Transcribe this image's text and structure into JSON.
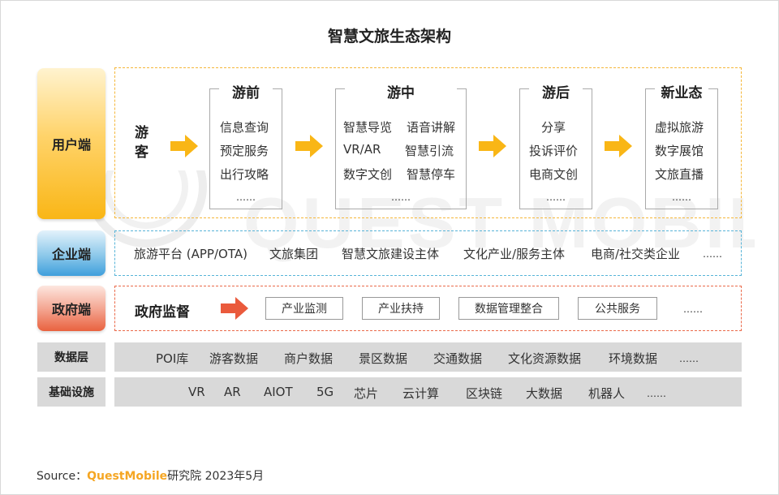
{
  "title": "智慧文旅生态架构",
  "watermark": "QUEST MOBILE",
  "layers": {
    "user": "用户端",
    "enterprise": "企业端",
    "government": "政府端",
    "data": "数据层",
    "infrastructure": "基础设施"
  },
  "user_layer": {
    "traveler": "游客",
    "stages": [
      {
        "title": "游前",
        "items": [
          "信息查询",
          "预定服务",
          "出行攻略"
        ],
        "more": "……"
      },
      {
        "title": "游中",
        "items": [
          "智慧导览",
          "语音讲解",
          "VR/AR",
          "智慧引流",
          "数字文创",
          "智慧停车"
        ],
        "more": "……"
      },
      {
        "title": "游后",
        "items": [
          "分享",
          "投诉评价",
          "电商文创"
        ],
        "more": "……"
      },
      {
        "title": "新业态",
        "items": [
          "虚拟旅游",
          "数字展馆",
          "文旅直播"
        ],
        "more": "……"
      }
    ]
  },
  "enterprise_layer": {
    "items": [
      "旅游平台 (APP/OTA)",
      "文旅集团",
      "智慧文旅建设主体",
      "文化产业/服务主体",
      "电商/社交类企业",
      "……"
    ]
  },
  "government_layer": {
    "label": "政府监督",
    "items": [
      "产业监测",
      "产业扶持",
      "数据管理整合",
      "公共服务"
    ],
    "more": "……"
  },
  "data_layer": {
    "items": [
      "POI库",
      "游客数据",
      "商户数据",
      "景区数据",
      "交通数据",
      "文化资源数据",
      "环境数据",
      "……"
    ]
  },
  "infra_layer": {
    "items": [
      "VR",
      "AR",
      "AIOT",
      "5G",
      "芯片",
      "云计算",
      "区块链",
      "大数据",
      "机器人",
      "……"
    ]
  },
  "source": {
    "prefix": "Source：",
    "brand": "QuestMobile",
    "suffix": "研究院 2023年5月"
  },
  "colors": {
    "user": "#f9b616",
    "enterprise": "#3f9fdc",
    "government": "#e9623f",
    "arrow_orange": "#f9b616",
    "arrow_red": "#ea5a3c",
    "brand": "#f5a623"
  }
}
